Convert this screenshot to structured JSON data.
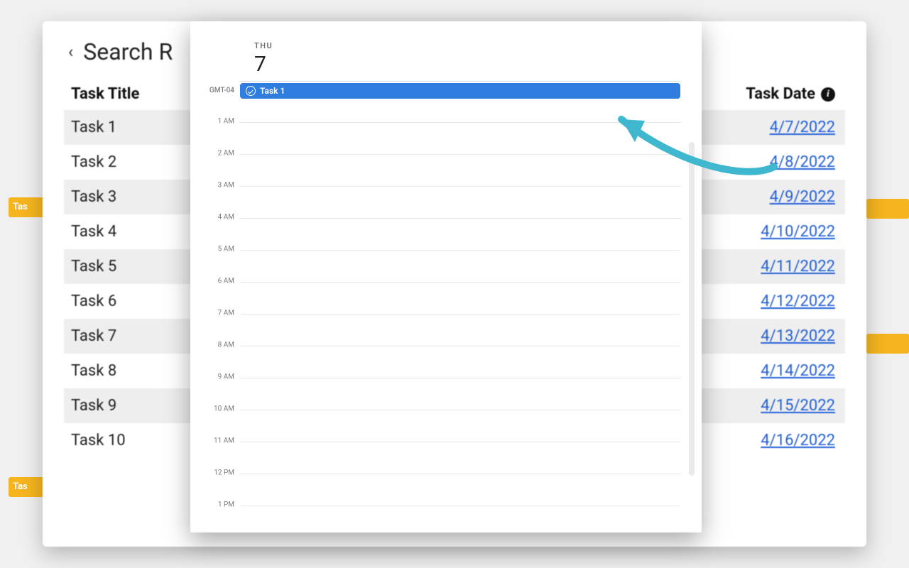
{
  "header": {
    "title": "Search R"
  },
  "columns": {
    "task_title": "Task Title",
    "task_date": "Task Date"
  },
  "tasks": [
    {
      "title": "Task 1",
      "date": "4/7/2022"
    },
    {
      "title": "Task 2",
      "date": "4/8/2022"
    },
    {
      "title": "Task 3",
      "date": "4/9/2022"
    },
    {
      "title": "Task 4",
      "date": "4/10/2022"
    },
    {
      "title": "Task 5",
      "date": "4/11/2022"
    },
    {
      "title": "Task 6",
      "date": "4/12/2022"
    },
    {
      "title": "Task 7",
      "date": "4/13/2022"
    },
    {
      "title": "Task 8",
      "date": "4/14/2022"
    },
    {
      "title": "Task 9",
      "date": "4/15/2022"
    },
    {
      "title": "Task 10",
      "date": "4/16/2022"
    }
  ],
  "bg_bar_label": "Tas",
  "calendar": {
    "day_of_week": "THU",
    "day_number": "7",
    "timezone": "GMT-04",
    "event_title": "Task 1",
    "hours": [
      "1 AM",
      "2 AM",
      "3 AM",
      "4 AM",
      "5 AM",
      "6 AM",
      "7 AM",
      "8 AM",
      "9 AM",
      "10 AM",
      "11 AM",
      "12 PM",
      "1 PM"
    ],
    "hour_spacing_px": 45
  }
}
